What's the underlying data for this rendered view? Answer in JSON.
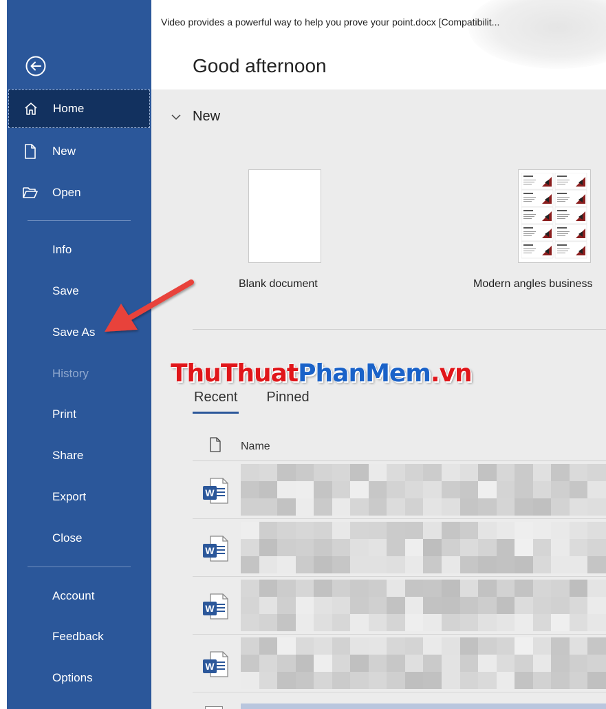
{
  "window": {
    "doc_title": "Video provides a powerful way to help you prove your point.docx [Compatibilit..."
  },
  "header": {
    "greeting": "Good afternoon"
  },
  "sidebar": {
    "back_icon": "back-arrow-circle-icon",
    "top_items": [
      {
        "label": "Home",
        "icon": "home-icon",
        "selected": true
      },
      {
        "label": "New",
        "icon": "new-document-icon"
      },
      {
        "label": "Open",
        "icon": "open-folder-icon"
      }
    ],
    "mid_items": [
      {
        "label": "Info"
      },
      {
        "label": "Save"
      },
      {
        "label": "Save As"
      },
      {
        "label": "History",
        "disabled": true
      },
      {
        "label": "Print"
      },
      {
        "label": "Share"
      },
      {
        "label": "Export"
      },
      {
        "label": "Close"
      }
    ],
    "bottom_items": [
      {
        "label": "Account"
      },
      {
        "label": "Feedback"
      },
      {
        "label": "Options"
      }
    ],
    "colors": {
      "background": "#2b579a",
      "selected": "#12315f"
    }
  },
  "new_section": {
    "heading": "New",
    "templates": [
      {
        "label": "Blank document"
      },
      {
        "label": "Modern angles business"
      }
    ]
  },
  "watermark": {
    "part1": "ThuThuat",
    "part2": "PhanMem",
    "part3": ".vn"
  },
  "recent": {
    "tabs": [
      {
        "label": "Recent",
        "active": true
      },
      {
        "label": "Pinned"
      }
    ],
    "column_name": "Name",
    "file_icon": "word-document-icon"
  },
  "annotation": {
    "arrow_target": "Save As",
    "color": "#e8423a"
  }
}
